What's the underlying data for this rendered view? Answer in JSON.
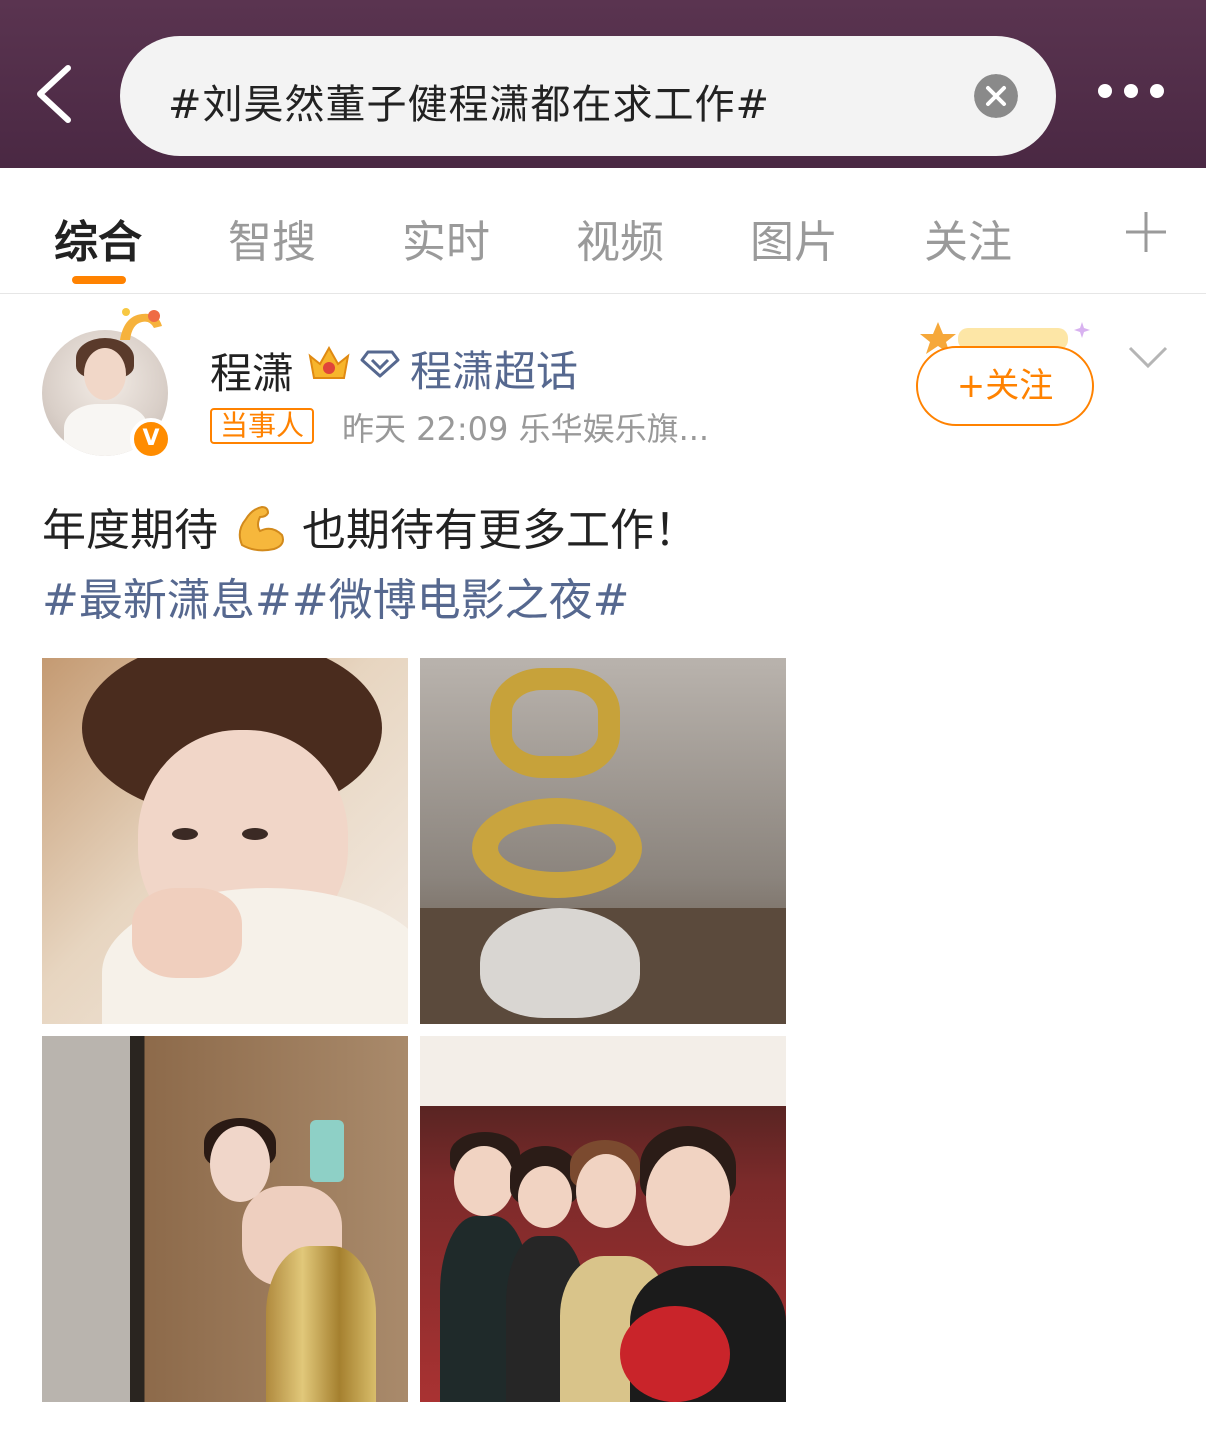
{
  "header": {
    "search_text": "#刘昊然董子健程潇都在求工作#",
    "back_icon": "chevron-left-icon",
    "clear_icon": "close-circle-icon",
    "more_icon": "more-horizontal-icon"
  },
  "tabs": {
    "items": [
      {
        "label": "综合",
        "active": true
      },
      {
        "label": "智搜",
        "active": false
      },
      {
        "label": "实时",
        "active": false
      },
      {
        "label": "视频",
        "active": false
      },
      {
        "label": "图片",
        "active": false
      },
      {
        "label": "关注",
        "active": false
      }
    ],
    "add_icon": "plus-icon"
  },
  "post": {
    "username": "程潇",
    "supertopic": "程潇超话",
    "badge": "当事人",
    "meta": "昨天 22:09  乐华娱乐旗...",
    "follow_label": "+关注",
    "verified_label": "V",
    "text": "年度期待",
    "text_after": " 也期待有更多工作！",
    "hashtags": "#最新潇息##微博电影之夜#",
    "images": [
      {
        "alt": "selfie-portrait"
      },
      {
        "alt": "golden-film-trophy"
      },
      {
        "alt": "mirror-selfie-gold-dress"
      },
      {
        "alt": "group-selfie-theater"
      }
    ]
  },
  "colors": {
    "header_bg": "#4f2c48",
    "accent": "#ff8200",
    "link": "#56688f"
  }
}
